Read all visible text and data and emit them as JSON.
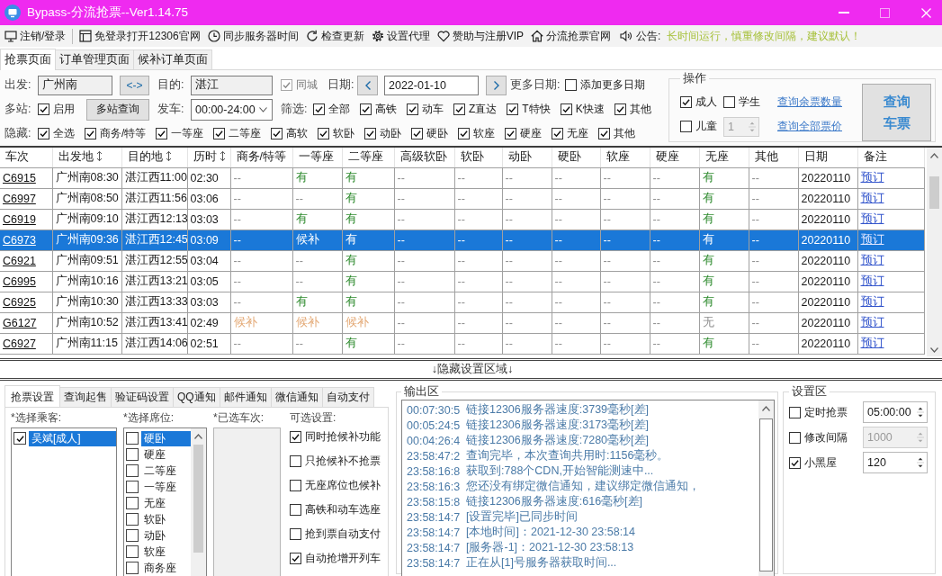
{
  "window": {
    "title": "Bypass-分流抢票--Ver1.14.75"
  },
  "toolbar": {
    "items": [
      {
        "label": "注销/登录"
      },
      {
        "label": "免登录打开12306官网"
      },
      {
        "label": "同步服务器时间"
      },
      {
        "label": "检查更新"
      },
      {
        "label": "设置代理"
      },
      {
        "label": "赞助与注册VIP"
      },
      {
        "label": "分流抢票官网"
      }
    ],
    "notice": {
      "label": "公告:",
      "text": "长时间运行，慎重修改间隔，建议默认！"
    }
  },
  "tabs": [
    {
      "label": "抢票页面",
      "selected": true
    },
    {
      "label": "订单管理页面",
      "selected": false
    },
    {
      "label": "候补订单页面",
      "selected": false
    }
  ],
  "search_form": {
    "from": {
      "label": "出发:",
      "value": "广州南"
    },
    "swap_button": "<->",
    "to": {
      "label": "目的:",
      "value": "湛江"
    },
    "same_city": {
      "label": "同城",
      "checked": true,
      "disabled": true
    },
    "date": {
      "label": "日期:",
      "value": "2022-01-10"
    },
    "more_dates": {
      "label": "更多日期:",
      "option": {
        "label": "添加更多日期",
        "checked": false
      }
    },
    "multi_station": {
      "label": "多站:",
      "option": {
        "label": "启用",
        "checked": true
      },
      "button": "多站查询"
    },
    "departure": {
      "label": "发车:",
      "value": "00:00-24:00"
    },
    "filter": {
      "label": "筛选:",
      "options": [
        {
          "label": "全部",
          "checked": true
        },
        {
          "label": "高铁",
          "checked": true
        },
        {
          "label": "动车",
          "checked": true
        },
        {
          "label": "Z直达",
          "checked": true
        },
        {
          "label": "T特快",
          "checked": true
        },
        {
          "label": "K快速",
          "checked": true
        },
        {
          "label": "其他",
          "checked": true
        }
      ]
    },
    "hide": {
      "label": "隐藏:",
      "options": [
        {
          "label": "全选",
          "checked": true
        },
        {
          "label": "商务/特等",
          "checked": true
        },
        {
          "label": "一等座",
          "checked": true
        },
        {
          "label": "二等座",
          "checked": true
        },
        {
          "label": "高软",
          "checked": true
        },
        {
          "label": "软卧",
          "checked": true
        },
        {
          "label": "动卧",
          "checked": true
        },
        {
          "label": "硬卧",
          "checked": true
        },
        {
          "label": "软座",
          "checked": true
        },
        {
          "label": "硬座",
          "checked": true
        },
        {
          "label": "无座",
          "checked": true
        },
        {
          "label": "其他",
          "checked": true
        }
      ]
    }
  },
  "operations": {
    "title": "操作",
    "passengers": [
      {
        "label": "成人",
        "checked": true
      },
      {
        "label": "学生",
        "checked": false
      },
      {
        "label": "儿童",
        "checked": false
      }
    ],
    "child_count": {
      "value": "1",
      "disabled": true
    },
    "links": [
      "查询余票数量",
      "查询全部票价"
    ],
    "query_button": "查询车票"
  },
  "table": {
    "columns": [
      {
        "label": "车次",
        "sortable": false
      },
      {
        "label": "出发地",
        "sortable": true
      },
      {
        "label": "目的地",
        "sortable": true
      },
      {
        "label": "历时",
        "sortable": true
      },
      {
        "label": "商务/特等",
        "sortable": false
      },
      {
        "label": "一等座",
        "sortable": false
      },
      {
        "label": "二等座",
        "sortable": false
      },
      {
        "label": "高级软卧",
        "sortable": false
      },
      {
        "label": "软卧",
        "sortable": false
      },
      {
        "label": "动卧",
        "sortable": false
      },
      {
        "label": "硬卧",
        "sortable": false
      },
      {
        "label": "软座",
        "sortable": false
      },
      {
        "label": "硬座",
        "sortable": false
      },
      {
        "label": "无座",
        "sortable": false
      },
      {
        "label": "其他",
        "sortable": false
      },
      {
        "label": "日期",
        "sortable": false
      },
      {
        "label": "备注",
        "sortable": false
      }
    ],
    "rows": [
      {
        "selected": false,
        "train": "C6915",
        "from": "广州南08:30",
        "to": "湛江西11:00",
        "duration": "02:30",
        "seats": [
          {
            "text": "--",
            "kind": "empty"
          },
          {
            "text": "有",
            "kind": "available"
          },
          {
            "text": "有",
            "kind": "available"
          },
          {
            "text": "--",
            "kind": "empty"
          },
          {
            "text": "--",
            "kind": "empty"
          },
          {
            "text": "--",
            "kind": "empty"
          },
          {
            "text": "--",
            "kind": "empty"
          },
          {
            "text": "--",
            "kind": "empty"
          },
          {
            "text": "--",
            "kind": "empty"
          },
          {
            "text": "有",
            "kind": "available"
          },
          {
            "text": "--",
            "kind": "empty"
          }
        ],
        "date": "20220110",
        "action": "预订"
      },
      {
        "selected": false,
        "train": "C6997",
        "from": "广州南08:50",
        "to": "湛江西11:56",
        "duration": "03:06",
        "seats": [
          {
            "text": "--",
            "kind": "empty"
          },
          {
            "text": "--",
            "kind": "empty"
          },
          {
            "text": "有",
            "kind": "available"
          },
          {
            "text": "--",
            "kind": "empty"
          },
          {
            "text": "--",
            "kind": "empty"
          },
          {
            "text": "--",
            "kind": "empty"
          },
          {
            "text": "--",
            "kind": "empty"
          },
          {
            "text": "--",
            "kind": "empty"
          },
          {
            "text": "--",
            "kind": "empty"
          },
          {
            "text": "有",
            "kind": "available"
          },
          {
            "text": "--",
            "kind": "empty"
          }
        ],
        "date": "20220110",
        "action": "预订"
      },
      {
        "selected": false,
        "train": "C6919",
        "from": "广州南09:10",
        "to": "湛江西12:13",
        "duration": "03:03",
        "seats": [
          {
            "text": "--",
            "kind": "empty"
          },
          {
            "text": "有",
            "kind": "available"
          },
          {
            "text": "有",
            "kind": "available"
          },
          {
            "text": "--",
            "kind": "empty"
          },
          {
            "text": "--",
            "kind": "empty"
          },
          {
            "text": "--",
            "kind": "empty"
          },
          {
            "text": "--",
            "kind": "empty"
          },
          {
            "text": "--",
            "kind": "empty"
          },
          {
            "text": "--",
            "kind": "empty"
          },
          {
            "text": "有",
            "kind": "available"
          },
          {
            "text": "--",
            "kind": "empty"
          }
        ],
        "date": "20220110",
        "action": "预订"
      },
      {
        "selected": true,
        "train": "C6973",
        "from": "广州南09:36",
        "to": "湛江西12:45",
        "duration": "03:09",
        "seats": [
          {
            "text": "--",
            "kind": "empty"
          },
          {
            "text": "候补",
            "kind": "waitlist"
          },
          {
            "text": "有",
            "kind": "available"
          },
          {
            "text": "--",
            "kind": "empty"
          },
          {
            "text": "--",
            "kind": "empty"
          },
          {
            "text": "--",
            "kind": "empty"
          },
          {
            "text": "--",
            "kind": "empty"
          },
          {
            "text": "--",
            "kind": "empty"
          },
          {
            "text": "--",
            "kind": "empty"
          },
          {
            "text": "有",
            "kind": "available"
          },
          {
            "text": "--",
            "kind": "empty"
          }
        ],
        "date": "20220110",
        "action": "预订"
      },
      {
        "selected": false,
        "train": "C6921",
        "from": "广州南09:51",
        "to": "湛江西12:55",
        "duration": "03:04",
        "seats": [
          {
            "text": "--",
            "kind": "empty"
          },
          {
            "text": "--",
            "kind": "empty"
          },
          {
            "text": "有",
            "kind": "available"
          },
          {
            "text": "--",
            "kind": "empty"
          },
          {
            "text": "--",
            "kind": "empty"
          },
          {
            "text": "--",
            "kind": "empty"
          },
          {
            "text": "--",
            "kind": "empty"
          },
          {
            "text": "--",
            "kind": "empty"
          },
          {
            "text": "--",
            "kind": "empty"
          },
          {
            "text": "有",
            "kind": "available"
          },
          {
            "text": "--",
            "kind": "empty"
          }
        ],
        "date": "20220110",
        "action": "预订"
      },
      {
        "selected": false,
        "train": "C6995",
        "from": "广州南10:16",
        "to": "湛江西13:21",
        "duration": "03:05",
        "seats": [
          {
            "text": "--",
            "kind": "empty"
          },
          {
            "text": "--",
            "kind": "empty"
          },
          {
            "text": "有",
            "kind": "available"
          },
          {
            "text": "--",
            "kind": "empty"
          },
          {
            "text": "--",
            "kind": "empty"
          },
          {
            "text": "--",
            "kind": "empty"
          },
          {
            "text": "--",
            "kind": "empty"
          },
          {
            "text": "--",
            "kind": "empty"
          },
          {
            "text": "--",
            "kind": "empty"
          },
          {
            "text": "有",
            "kind": "available"
          },
          {
            "text": "--",
            "kind": "empty"
          }
        ],
        "date": "20220110",
        "action": "预订"
      },
      {
        "selected": false,
        "train": "C6925",
        "from": "广州南10:30",
        "to": "湛江西13:33",
        "duration": "03:03",
        "seats": [
          {
            "text": "--",
            "kind": "empty"
          },
          {
            "text": "有",
            "kind": "available"
          },
          {
            "text": "有",
            "kind": "available"
          },
          {
            "text": "--",
            "kind": "empty"
          },
          {
            "text": "--",
            "kind": "empty"
          },
          {
            "text": "--",
            "kind": "empty"
          },
          {
            "text": "--",
            "kind": "empty"
          },
          {
            "text": "--",
            "kind": "empty"
          },
          {
            "text": "--",
            "kind": "empty"
          },
          {
            "text": "有",
            "kind": "available"
          },
          {
            "text": "--",
            "kind": "empty"
          }
        ],
        "date": "20220110",
        "action": "预订"
      },
      {
        "selected": false,
        "train": "G6127",
        "from": "广州南10:52",
        "to": "湛江西13:41",
        "duration": "02:49",
        "seats": [
          {
            "text": "候补",
            "kind": "waitlist"
          },
          {
            "text": "候补",
            "kind": "waitlist"
          },
          {
            "text": "候补",
            "kind": "waitlist"
          },
          {
            "text": "--",
            "kind": "empty"
          },
          {
            "text": "--",
            "kind": "empty"
          },
          {
            "text": "--",
            "kind": "empty"
          },
          {
            "text": "--",
            "kind": "empty"
          },
          {
            "text": "--",
            "kind": "empty"
          },
          {
            "text": "--",
            "kind": "empty"
          },
          {
            "text": "无",
            "kind": "soldout"
          },
          {
            "text": "--",
            "kind": "empty"
          }
        ],
        "date": "20220110",
        "action": "预订"
      },
      {
        "selected": false,
        "train": "C6927",
        "from": "广州南11:15",
        "to": "湛江西14:06",
        "duration": "02:51",
        "seats": [
          {
            "text": "--",
            "kind": "empty"
          },
          {
            "text": "--",
            "kind": "empty"
          },
          {
            "text": "有",
            "kind": "available"
          },
          {
            "text": "--",
            "kind": "empty"
          },
          {
            "text": "--",
            "kind": "empty"
          },
          {
            "text": "--",
            "kind": "empty"
          },
          {
            "text": "--",
            "kind": "empty"
          },
          {
            "text": "--",
            "kind": "empty"
          },
          {
            "text": "--",
            "kind": "empty"
          },
          {
            "text": "有",
            "kind": "available"
          },
          {
            "text": "--",
            "kind": "empty"
          }
        ],
        "date": "20220110",
        "action": "预订"
      }
    ]
  },
  "settings_toggle": "↓隐藏设置区域↓",
  "settings_tabs": [
    {
      "label": "抢票设置",
      "selected": true
    },
    {
      "label": "查询起售",
      "selected": false
    },
    {
      "label": "验证码设置",
      "selected": false
    },
    {
      "label": "QQ通知",
      "selected": false
    },
    {
      "label": "邮件通知",
      "selected": false
    },
    {
      "label": "微信通知",
      "selected": false
    },
    {
      "label": "自动支付",
      "selected": false
    }
  ],
  "grab_settings": {
    "passengers": {
      "label": "*选择乘客:",
      "items": [
        {
          "label": "吴斌[成人]",
          "checked": true,
          "selected": true
        }
      ]
    },
    "seats": {
      "label": "*选择席位:",
      "items": [
        {
          "label": "硬卧",
          "checked": false,
          "selected": true
        },
        {
          "label": "硬座",
          "checked": false,
          "selected": false
        },
        {
          "label": "二等座",
          "checked": false,
          "selected": false
        },
        {
          "label": "一等座",
          "checked": false,
          "selected": false
        },
        {
          "label": "无座",
          "checked": false,
          "selected": false
        },
        {
          "label": "软卧",
          "checked": false,
          "selected": false
        },
        {
          "label": "动卧",
          "checked": false,
          "selected": false
        },
        {
          "label": "软座",
          "checked": false,
          "selected": false
        },
        {
          "label": "商务座",
          "checked": false,
          "selected": false
        }
      ]
    },
    "selected_trains": {
      "label": "*已选车次:"
    },
    "options": {
      "label": "可选设置:",
      "items": [
        {
          "label": "同时抢候补功能",
          "checked": true
        },
        {
          "label": "只抢候补不抢票",
          "checked": false
        },
        {
          "label": "无座席位也候补",
          "checked": false
        },
        {
          "label": "高铁和动车选座",
          "checked": false
        },
        {
          "label": "抢到票自动支付",
          "checked": false
        },
        {
          "label": "自动抢增开列车",
          "checked": true
        }
      ]
    }
  },
  "output": {
    "title": "输出区",
    "lines": [
      {
        "time": "00:07:30:5",
        "text": "链接12306服务器速度:3739毫秒[差]"
      },
      {
        "time": "00:05:24:5",
        "text": "链接12306服务器速度:3173毫秒[差]"
      },
      {
        "time": "00:04:26:4",
        "text": "链接12306服务器速度:7280毫秒[差]"
      },
      {
        "time": "23:58:47:2",
        "text": "查询完毕，本次查询共用时:1156毫秒。"
      },
      {
        "time": "23:58:16:8",
        "text": "获取到:788个CDN,开始智能测速中..."
      },
      {
        "time": "23:58:16:3",
        "text": "您还没有绑定微信通知，建议绑定微信通知，"
      },
      {
        "time": "23:58:15:8",
        "text": "链接12306服务器速度:616毫秒[差]"
      },
      {
        "time": "23:58:14:7",
        "text": "[设置完毕]已同步时间"
      },
      {
        "time": "23:58:14:7",
        "text": "[本地时间]：2021-12-30 23:58:14"
      },
      {
        "time": "23:58:14:7",
        "text": "[服务器-1]：2021-12-30 23:58:13"
      },
      {
        "time": "23:58:14:7",
        "text": "正在从[1]号服务器获取时间..."
      }
    ]
  },
  "settings_area": {
    "title": "设置区",
    "rows": [
      {
        "label": "定时抢票",
        "checked": false,
        "value": "05:00:00",
        "disabled": false
      },
      {
        "label": "修改间隔",
        "checked": false,
        "value": "1000",
        "disabled": true
      },
      {
        "label": "小黑屋",
        "checked": true,
        "value": "120",
        "disabled": false
      }
    ]
  }
}
